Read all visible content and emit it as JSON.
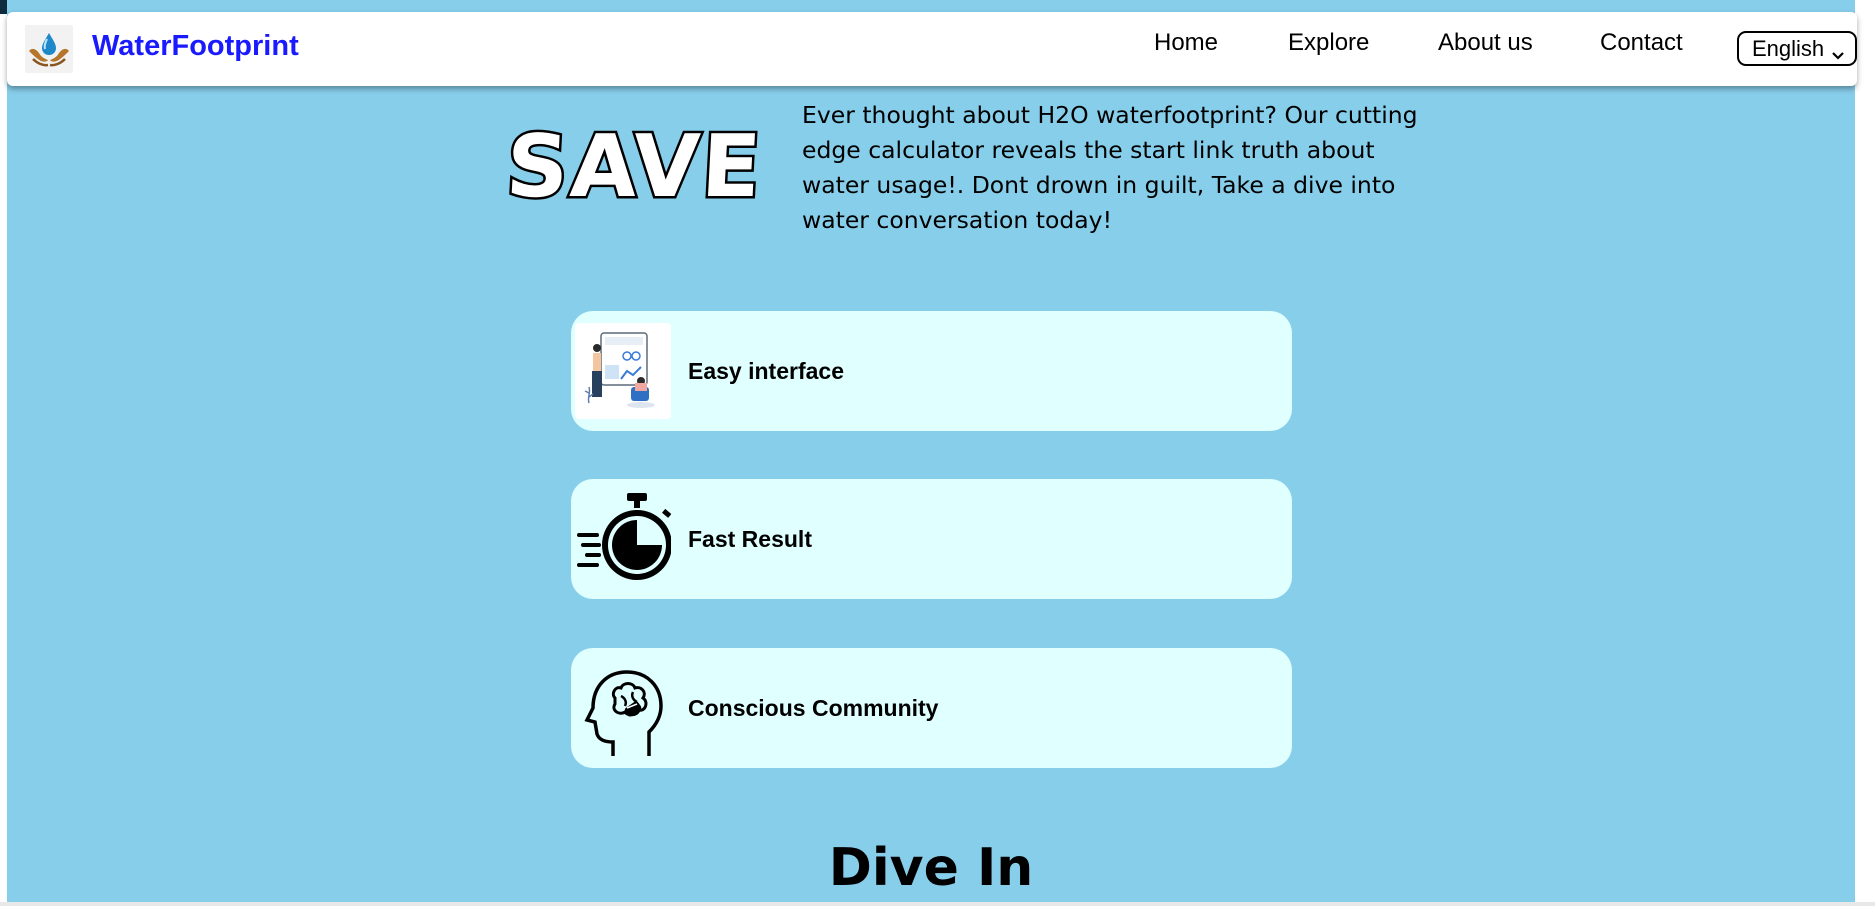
{
  "navbar": {
    "brand": "WaterFootprint",
    "links": [
      "Home",
      "Explore",
      "About us",
      "Contact"
    ],
    "language": {
      "selected": "English"
    }
  },
  "hero": {
    "save_word": "SAVE",
    "intro": "Ever thought about H2O waterfootprint? Our cutting edge calculator reveals the start link truth about water usage!. Dont drown in guilt, Take a dive into water conversation today!"
  },
  "features": [
    {
      "label": "Easy interface",
      "icon": "dashboard-illustration-icon"
    },
    {
      "label": "Fast Result",
      "icon": "stopwatch-icon"
    },
    {
      "label": "Conscious Community",
      "icon": "brain-head-icon"
    }
  ],
  "section": {
    "title": "Dive In"
  },
  "colors": {
    "page_bg": "#87ceeb",
    "card_bg": "#e0ffff",
    "brand": "#1a1aff"
  }
}
